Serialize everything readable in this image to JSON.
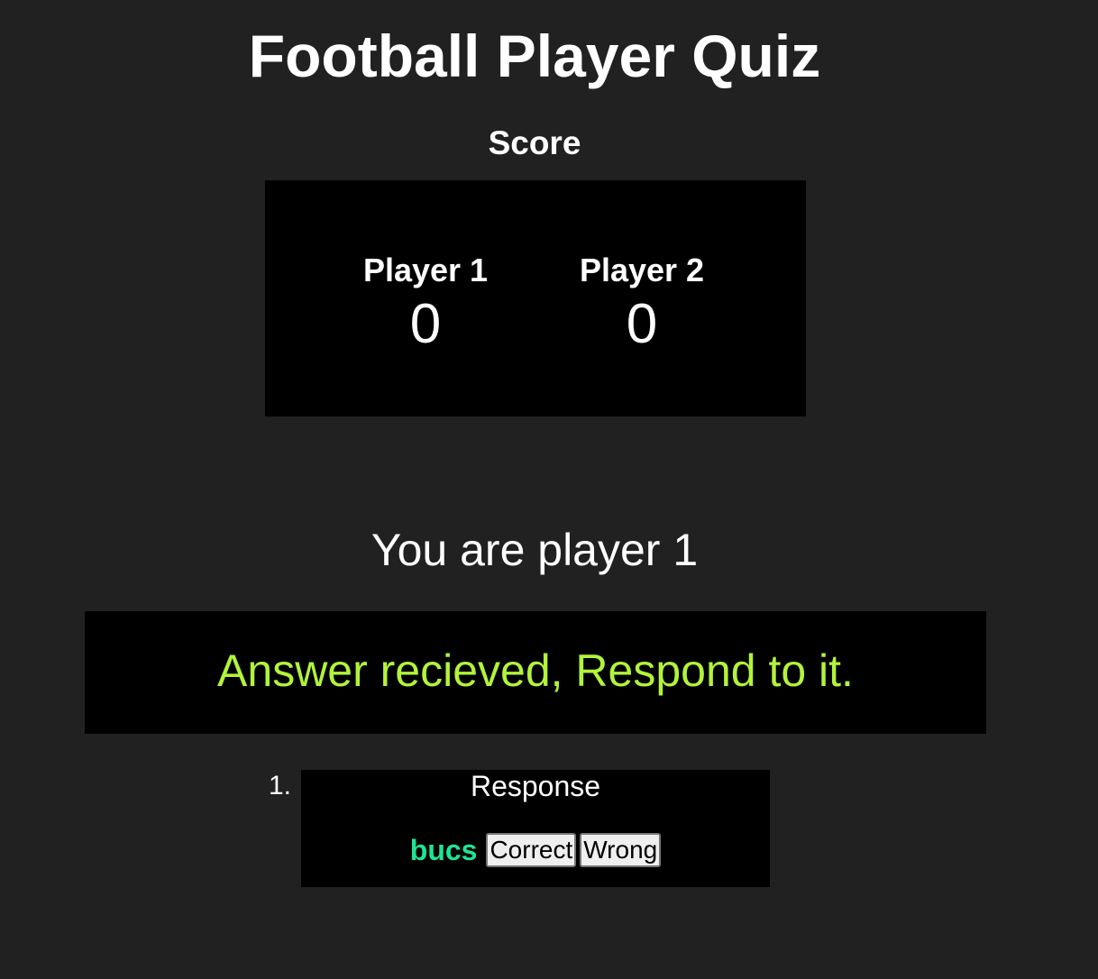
{
  "page": {
    "title": "Football Player Quiz"
  },
  "score": {
    "heading": "Score",
    "players": [
      {
        "name": "Player 1",
        "score": "0"
      },
      {
        "name": "Player 2",
        "score": "0"
      }
    ]
  },
  "identity": "You are player 1",
  "status": {
    "message": "Answer recieved, Respond to it.",
    "color": "#b2f33b"
  },
  "responses": [
    {
      "number": "1.",
      "title": "Response",
      "answer": "bucs",
      "answer_color": "#1ee494",
      "correct_label": "Correct",
      "wrong_label": "Wrong"
    }
  ],
  "colors": {
    "background": "#212121",
    "panel": "#000000",
    "text": "#ffffff"
  }
}
